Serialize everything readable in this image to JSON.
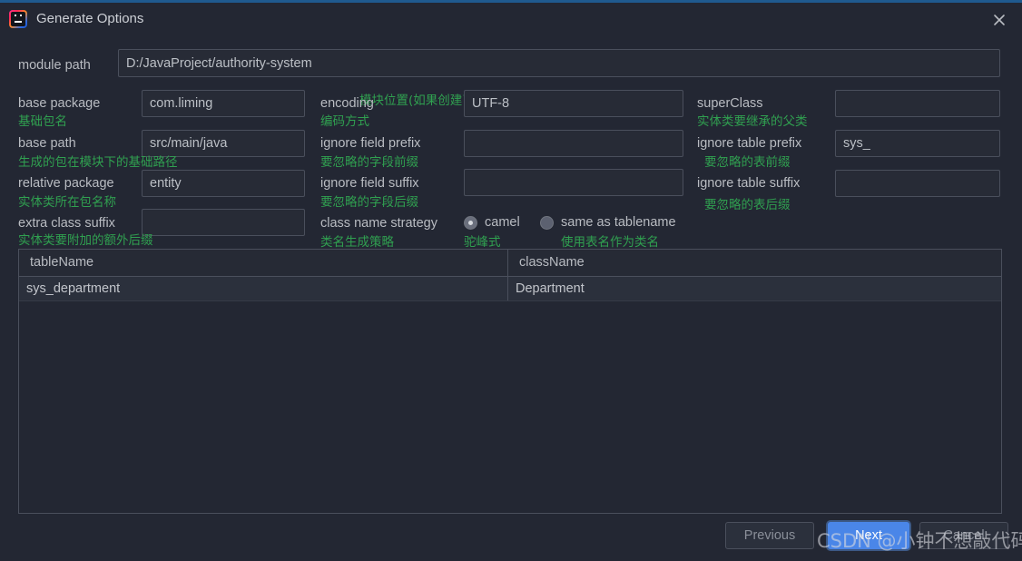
{
  "window": {
    "title": "Generate Options",
    "app_icon": "intellij-idea-icon",
    "close_icon": "close-icon",
    "accent_color": "#1f5a8f"
  },
  "module_path": {
    "label": "module path",
    "value": "D:/JavaProject/authority-system",
    "hint": "模块位置(如果创建了多个module,点击这个会让你选择)"
  },
  "columns": {
    "left": [
      {
        "label": "base package",
        "value": "com.liming",
        "hint": "基础包名"
      },
      {
        "label": "base path",
        "value": "src/main/java",
        "hint": "生成的包在模块下的基础路径"
      },
      {
        "label": "relative package",
        "value": "entity",
        "hint": "实体类所在包名称"
      },
      {
        "label": "extra class suffix",
        "value": "",
        "hint": "实体类要附加的额外后缀"
      }
    ],
    "middle": [
      {
        "label": "encoding",
        "value": "UTF-8",
        "hint": "编码方式"
      },
      {
        "label": "ignore field prefix",
        "value": "",
        "hint": "要忽略的字段前缀"
      },
      {
        "label": "ignore field suffix",
        "value": "",
        "hint": "要忽略的字段后缀"
      }
    ],
    "right": [
      {
        "label": "superClass",
        "value": "",
        "hint": "实体类要继承的父类"
      },
      {
        "label": "ignore table prefix",
        "value": "sys_",
        "hint": "要忽略的表前缀"
      },
      {
        "label": "ignore table suffix",
        "value": "",
        "hint": "要忽略的表后缀"
      }
    ]
  },
  "class_name_strategy": {
    "label": "class name strategy",
    "hint": "类名生成策略",
    "options": [
      {
        "label": "camel",
        "hint": "驼峰式",
        "selected": true
      },
      {
        "label": "same as tablename",
        "hint": "使用表名作为类名",
        "selected": false
      }
    ]
  },
  "table": {
    "headers": [
      "tableName",
      "className"
    ],
    "rows": [
      {
        "tableName": "sys_department",
        "className": "Department"
      }
    ]
  },
  "buttons": {
    "previous": "Previous",
    "next": "Next",
    "cancel": "Cancel"
  },
  "watermark": "CSDN @小钟不想敲代码"
}
